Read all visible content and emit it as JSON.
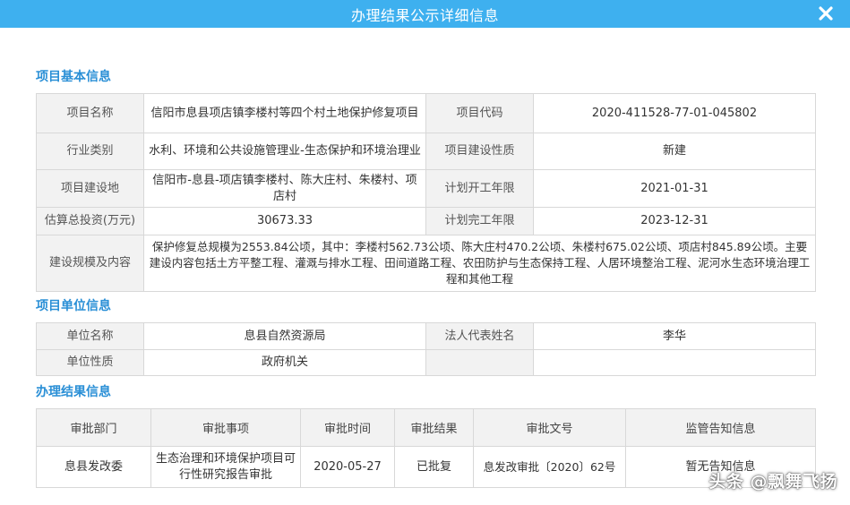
{
  "dialog": {
    "title": "办理结果公示详细信息",
    "close_icon": "close-icon"
  },
  "basic": {
    "heading": "项目基本信息",
    "project_name_label": "项目名称",
    "project_name": "信阳市息县项店镇李楼村等四个村土地保护修复项目",
    "project_code_label": "项目代码",
    "project_code": "2020-411528-77-01-045802",
    "industry_label": "行业类别",
    "industry": "水利、环境和公共设施管理业-生态保护和环境治理业",
    "nature_label": "项目建设性质",
    "nature": "新建",
    "location_label": "项目建设地",
    "location": "信阳市-息县-项店镇李楼村、陈大庄村、朱楼村、项店村",
    "start_label": "计划开工年限",
    "start": "2021-01-31",
    "investment_label": "估算总投资(万元)",
    "investment": "30673.33",
    "end_label": "计划完工年限",
    "end": "2023-12-31",
    "scale_label": "建设规模及内容",
    "scale": "保护修复总规模为2553.84公顷，其中：李楼村562.73公顷、陈大庄村470.2公顷、朱楼村675.02公顷、项店村845.89公顷。主要建设内容包括土方平整工程、灌溉与排水工程、田间道路工程、农田防护与生态保持工程、人居环境整治工程、泥河水生态环境治理工程和其他工程"
  },
  "unit": {
    "heading": "项目单位信息",
    "name_label": "单位名称",
    "name": "息县自然资源局",
    "rep_label": "法人代表姓名",
    "rep": "李华",
    "type_label": "单位性质",
    "type": "政府机关"
  },
  "result": {
    "heading": "办理结果信息",
    "headers": [
      "审批部门",
      "审批事项",
      "审批时间",
      "审批结果",
      "审批文号",
      "监管告知信息"
    ],
    "row": {
      "dept": "息县发改委",
      "item": "生态治理和环境保护项目可行性研究报告审批",
      "date": "2020-05-27",
      "status": "已批复",
      "doc_no": "息发改审批〔2020〕62号",
      "notice": "暂无告知信息"
    }
  },
  "watermark": "头条 @飘舞飞扬",
  "colors": {
    "titlebar": "#3eb0ef",
    "heading": "#2a8fd6",
    "label_bg": "#f2f2f2",
    "border": "#d8d8d8"
  }
}
